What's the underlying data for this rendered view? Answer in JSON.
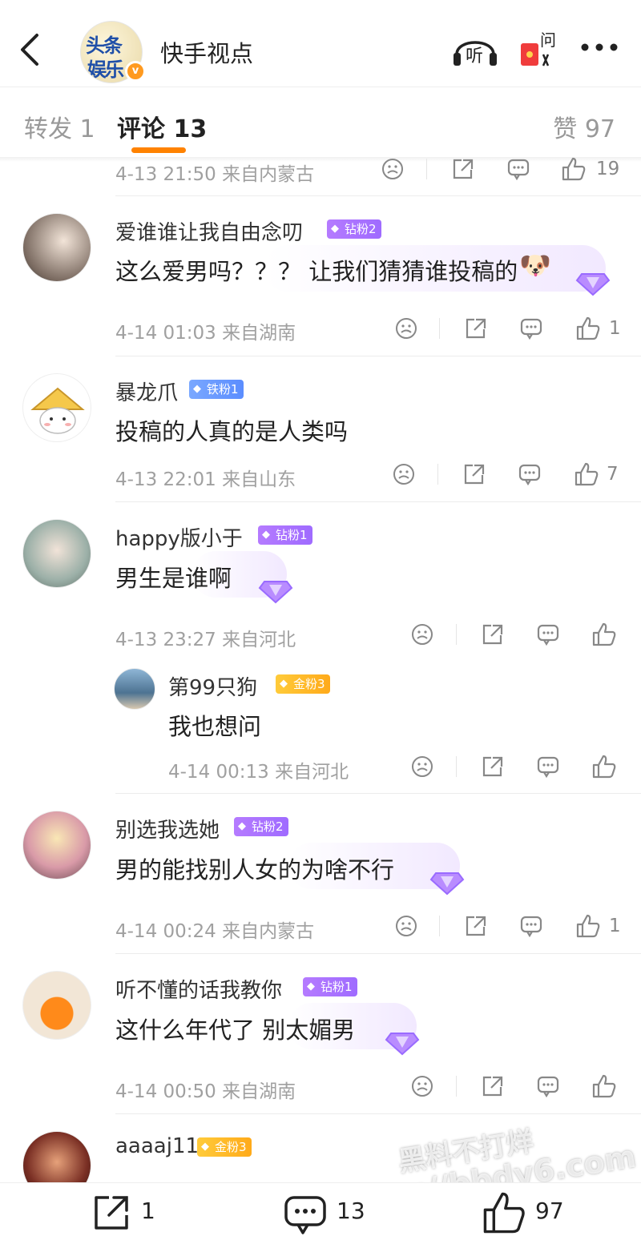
{
  "header": {
    "account_name": "快手视点",
    "avatar_text_line1": "头条",
    "avatar_text_line2": "娱乐",
    "listen_label": "听",
    "ask_label": "问"
  },
  "tabs": {
    "repost": "转发 1",
    "comment": "评论 13",
    "like": "赞 97"
  },
  "top_partial": {
    "meta": "4-13 21:50  来自内蒙古",
    "likes": "19"
  },
  "comments": [
    {
      "user": "爱谁谁让我自由念叨",
      "badge": "钻粉2",
      "text": "这么爱男吗？？？ 让我们猜猜谁投稿的",
      "emoji": "🐶",
      "meta": "4-14 01:03  来自湖南",
      "likes": "1"
    },
    {
      "user": "暴龙爪",
      "badge": "铁粉1",
      "text": "投稿的人真的是人类吗",
      "meta": "4-13 22:01  来自山东",
      "likes": "7"
    },
    {
      "user": "happy版小于",
      "badge": "钻粉1",
      "text": "男生是谁啊",
      "meta": "4-13 23:27  来自河北",
      "likes": ""
    },
    {
      "user": "第99只狗",
      "badge": "金粉3",
      "text": "我也想问",
      "meta": "4-14 00:13  来自河北",
      "likes": ""
    },
    {
      "user": "别选我选她",
      "badge": "钻粉2",
      "text": "男的能找别人女的为啥不行",
      "meta": "4-14 00:24  来自内蒙古",
      "likes": "1"
    },
    {
      "user": "听不懂的话我教你",
      "badge": "钻粉1",
      "text": "这什么年代了 别太媚男",
      "meta": "4-14 00:50  来自湖南",
      "likes": ""
    },
    {
      "user": "aaaaj11",
      "badge": "金粉3",
      "text": "",
      "meta": "",
      "likes": ""
    }
  ],
  "bottom": {
    "reposts": "1",
    "comments": "13",
    "likes": "97"
  },
  "watermark": {
    "line1": "黑料不打烊",
    "line2": "https://bbdy6.com"
  },
  "colors": {
    "accent": "#ff8200",
    "diamond_badge": "#a674ff",
    "iron_badge": "#6a9bff",
    "gold_badge": "#ffb726"
  }
}
